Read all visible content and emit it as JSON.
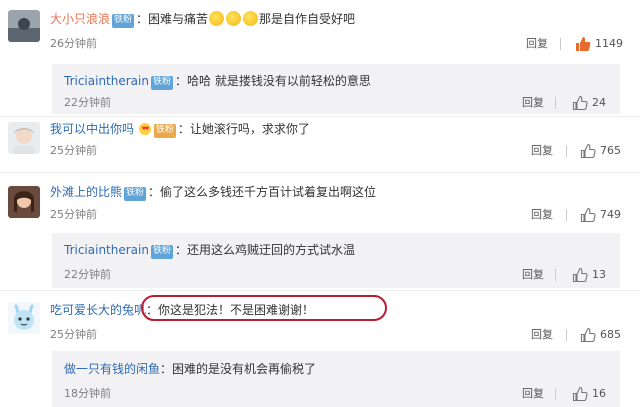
{
  "comments": [
    {
      "username": "大小只浪浪",
      "badge": "铁粉",
      "text_pre": "：困难与痛苦",
      "text_post": "那是自作自受好吧",
      "time": "26分钟前",
      "reply": "回复",
      "likes": "1149",
      "like_color": "#e86a2c"
    },
    {
      "username": "我可以中出你吗",
      "badge": "铁粉",
      "text_pre": "：让她滚行吗，求求你了",
      "time": "25分钟前",
      "reply": "回复",
      "likes": "765"
    },
    {
      "username": "外滩上的比熊",
      "badge": "铁粉",
      "text_pre": "：偷了这么多钱还千方百计试着复出啊这位",
      "time": "25分钟前",
      "reply": "回复",
      "likes": "749"
    },
    {
      "username": "吃可爱长大的兔叽",
      "badge": "",
      "text_pre": "：你这是犯法！不是困难谢谢！",
      "time": "25分钟前",
      "reply": "回复",
      "likes": "685"
    }
  ],
  "replies": [
    {
      "username": "Triciaintherain",
      "badge": "铁粉",
      "text": "：哈哈 就是搂钱没有以前轻松的意思",
      "time": "22分钟前",
      "reply": "回复",
      "likes": "24"
    },
    {
      "username": "Triciaintherain",
      "badge": "铁粉",
      "text": "：还用这么鸡贼迂回的方式试水温",
      "time": "22分钟前",
      "reply": "回复",
      "likes": "13"
    },
    {
      "username": "做一只有钱的闲鱼",
      "badge": "",
      "text": "：困难的是没有机会再偷税了",
      "time": "18分钟前",
      "reply": "回复",
      "likes": "16"
    }
  ],
  "colors": {
    "username": "#eb7350",
    "reply_username": "#2e6ab1",
    "highlight_ring": "#b81e2f",
    "like_active": "#e86a2c"
  }
}
